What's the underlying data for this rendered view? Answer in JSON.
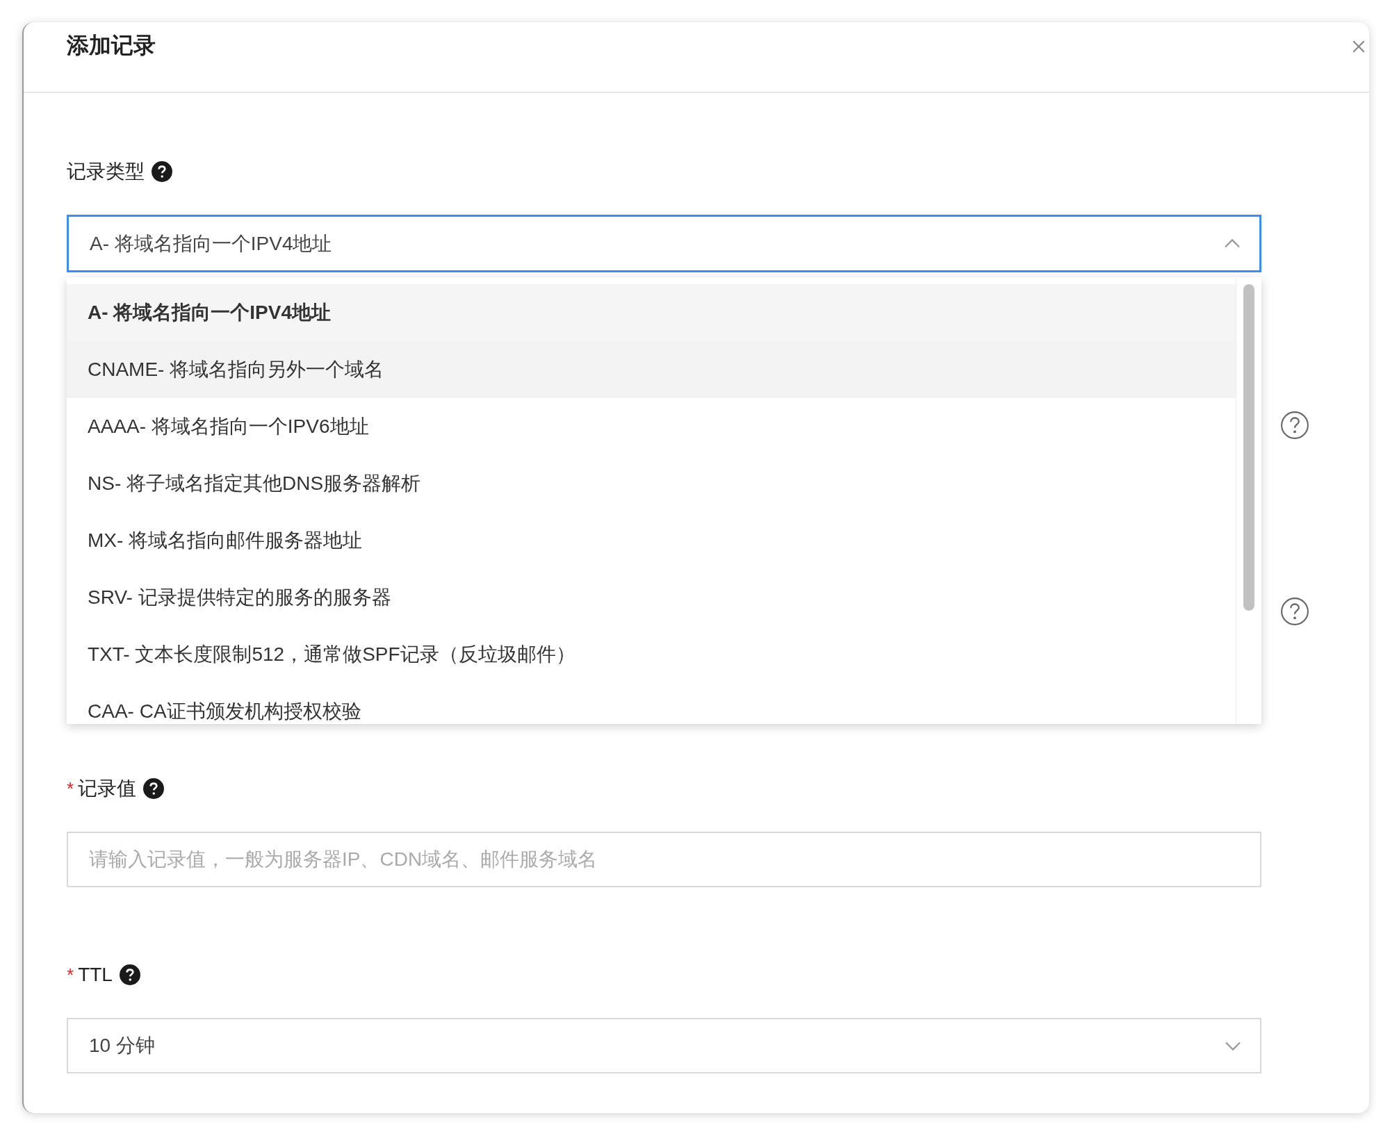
{
  "dialog": {
    "title": "添加记录"
  },
  "fields": [
    {
      "kind": "select",
      "label": "记录类型",
      "help": true,
      "value": "A- 将域名指向一个IPV4地址",
      "open": true,
      "options": [
        {
          "label": "A- 将域名指向一个IPV4地址",
          "selected": true,
          "hovered": false
        },
        {
          "label": "CNAME- 将域名指向另外一个域名",
          "selected": false,
          "hovered": true
        },
        {
          "label": "AAAA- 将域名指向一个IPV6地址",
          "selected": false,
          "hovered": false
        },
        {
          "label": "NS- 将子域名指定其他DNS服务器解析",
          "selected": false,
          "hovered": false
        },
        {
          "label": "MX- 将域名指向邮件服务器地址",
          "selected": false,
          "hovered": false
        },
        {
          "label": "SRV- 记录提供特定的服务的服务器",
          "selected": false,
          "hovered": false
        },
        {
          "label": "TXT- 文本长度限制512，通常做SPF记录（反垃圾邮件）",
          "selected": false,
          "hovered": false
        },
        {
          "label": "CAA- CA证书颁发机构授权校验",
          "selected": false,
          "hovered": false
        }
      ]
    },
    {
      "kind": "input",
      "label": "记录值",
      "required_mark": "*",
      "help": true,
      "placeholder": "请输入记录值，一般为服务器IP、CDN域名、邮件服务域名"
    },
    {
      "kind": "select",
      "label": "TTL",
      "required_mark": "*",
      "help": true,
      "value": "10 分钟",
      "open": false
    }
  ]
}
